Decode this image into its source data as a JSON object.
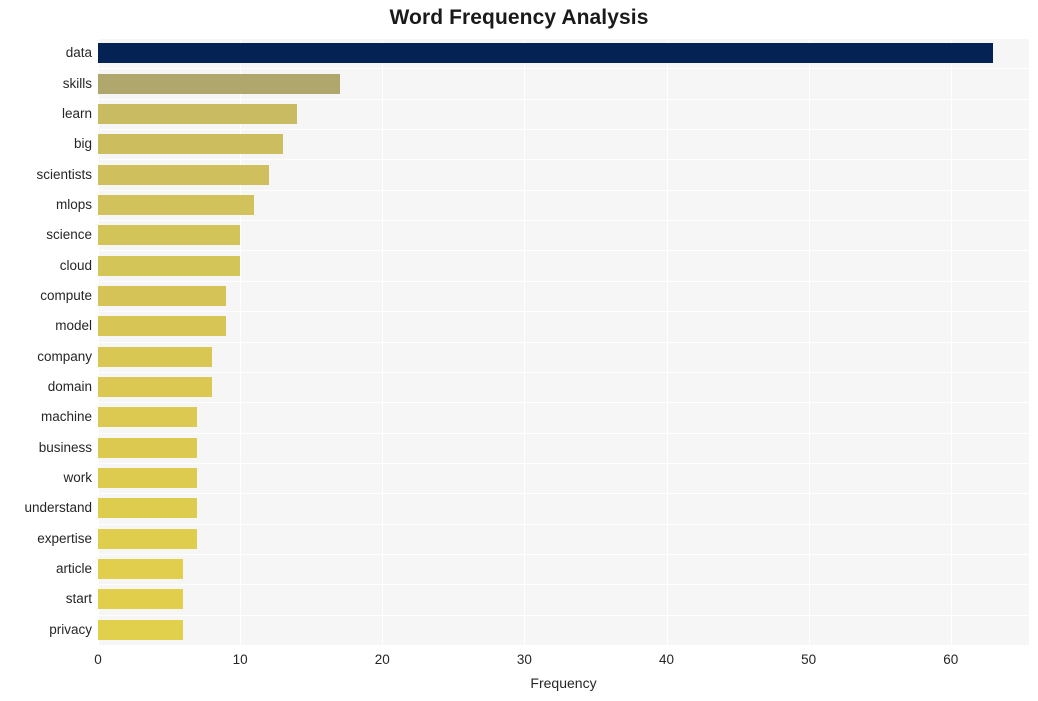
{
  "chart_data": {
    "type": "bar",
    "orientation": "horizontal",
    "title": "Word Frequency Analysis",
    "xlabel": "Frequency",
    "ylabel": "",
    "xlim": [
      0,
      65.5
    ],
    "xticks": [
      0,
      10,
      20,
      30,
      40,
      50,
      60
    ],
    "xtick_labels": [
      "0",
      "10",
      "20",
      "30",
      "40",
      "50",
      "60"
    ],
    "grid": true,
    "grid_color": "#ffffff",
    "plot_background": "#f6f6f6",
    "figure_background": "#ffffff",
    "legend": null,
    "categories": [
      "data",
      "skills",
      "learn",
      "big",
      "scientists",
      "mlops",
      "science",
      "cloud",
      "compute",
      "model",
      "company",
      "domain",
      "machine",
      "business",
      "work",
      "understand",
      "expertise",
      "article",
      "start",
      "privacy"
    ],
    "values": [
      63,
      17,
      14,
      13,
      12,
      11,
      10,
      10,
      9,
      9,
      8,
      8,
      7,
      7,
      7,
      7,
      7,
      6,
      6,
      6
    ],
    "bar_colors": [
      "#042253",
      "#b0a76c",
      "#c9bb62",
      "#ccbe5f",
      "#cfc05d",
      "#d1c25b",
      "#d3c459",
      "#d4c558",
      "#d6c358",
      "#d7c556",
      "#d9c754",
      "#dac853",
      "#dbc951",
      "#dcca50",
      "#ddcb4f",
      "#decc4e",
      "#dfcd4d",
      "#e0ce4c",
      "#e1cf4c",
      "#e1d04c"
    ]
  }
}
